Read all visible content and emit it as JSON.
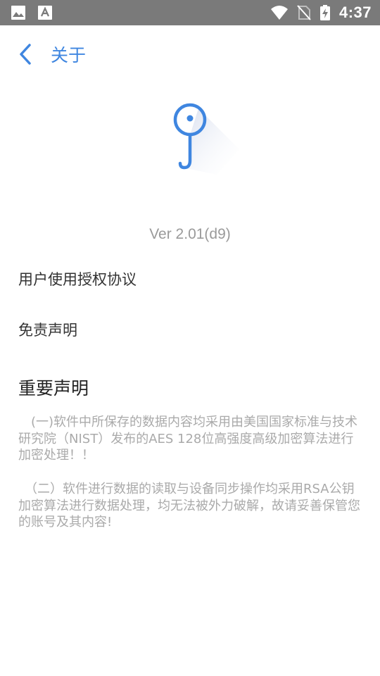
{
  "status_bar": {
    "time": "4:37",
    "left_icons": [
      "image-icon",
      "text-a-icon"
    ],
    "right_icons": [
      "wifi-icon",
      "no-sim-icon",
      "battery-charging-icon"
    ]
  },
  "app_bar": {
    "back_icon": "chevron-left-icon",
    "title": "关于"
  },
  "logo": {
    "icon": "key-icon",
    "color": "#3f86e0"
  },
  "version": "Ver 2.01(d9)",
  "menu": {
    "items": [
      {
        "label": "用户使用授权协议"
      },
      {
        "label": "免责声明"
      }
    ]
  },
  "notice": {
    "heading": "重要声明",
    "paragraphs": [
      "　(一)软件中所保存的数据内容均采用由美国国家标准与技术研究院（NIST）发布的AES 128位高强度高级加密算法进行加密处理！！",
      "　（二）软件进行数据的读取与设备同步操作均采用RSA公钥加密算法进行数据处理，均无法被外力破解，故请妥善保管您的账号及其内容!"
    ]
  },
  "colors": {
    "accent": "#3f86e0",
    "status_bar": "#7a7a7a",
    "muted_text": "#aaaaaa"
  }
}
